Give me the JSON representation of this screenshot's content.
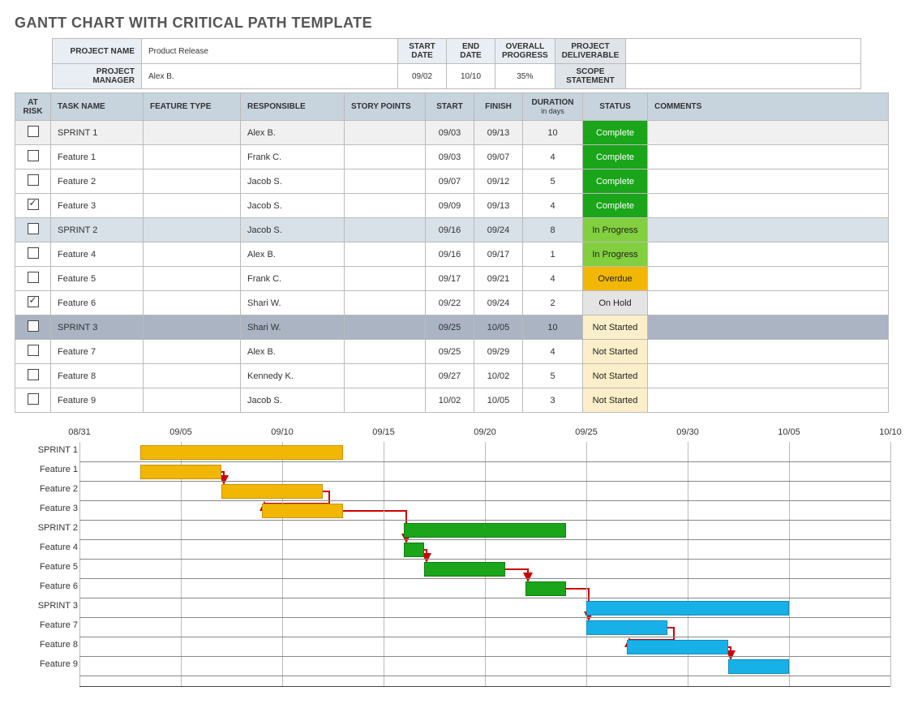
{
  "title": "GANTT CHART WITH CRITICAL PATH TEMPLATE",
  "info": {
    "labels": {
      "project_name": "PROJECT NAME",
      "project_manager": "PROJECT MANAGER",
      "start_date": "START DATE",
      "end_date": "END DATE",
      "overall_progress": "OVERALL PROGRESS",
      "deliverable": "PROJECT DELIVERABLE",
      "scope": "SCOPE STATEMENT"
    },
    "project_name": "Product Release",
    "project_manager": "Alex B.",
    "start_date": "09/02",
    "end_date": "10/10",
    "overall_progress": "35%"
  },
  "columns": {
    "at_risk": "AT RISK",
    "task_name": "TASK NAME",
    "feature_type": "FEATURE TYPE",
    "responsible": "RESPONSIBLE",
    "story_points": "STORY POINTS",
    "start": "START",
    "finish": "FINISH",
    "duration": "DURATION",
    "duration_sub": "in days",
    "status": "STATUS",
    "comments": "COMMENTS"
  },
  "rows": [
    {
      "risk": false,
      "name": "SPRINT 1",
      "resp": "Alex B.",
      "start": "09/03",
      "finish": "09/13",
      "dur": "10",
      "status": "Complete",
      "stclass": "st-complete",
      "cls": "sprint1"
    },
    {
      "risk": false,
      "name": "Feature 1",
      "resp": "Frank C.",
      "start": "09/03",
      "finish": "09/07",
      "dur": "4",
      "status": "Complete",
      "stclass": "st-complete",
      "cls": ""
    },
    {
      "risk": false,
      "name": "Feature 2",
      "resp": "Jacob S.",
      "start": "09/07",
      "finish": "09/12",
      "dur": "5",
      "status": "Complete",
      "stclass": "st-complete",
      "cls": ""
    },
    {
      "risk": true,
      "name": "Feature 3",
      "resp": "Jacob S.",
      "start": "09/09",
      "finish": "09/13",
      "dur": "4",
      "status": "Complete",
      "stclass": "st-complete",
      "cls": ""
    },
    {
      "risk": false,
      "name": "SPRINT 2",
      "resp": "Jacob S.",
      "start": "09/16",
      "finish": "09/24",
      "dur": "8",
      "status": "In Progress",
      "stclass": "st-inprogress",
      "cls": "sprint2"
    },
    {
      "risk": false,
      "name": "Feature 4",
      "resp": "Alex B.",
      "start": "09/16",
      "finish": "09/17",
      "dur": "1",
      "status": "In Progress",
      "stclass": "st-inprogress",
      "cls": ""
    },
    {
      "risk": false,
      "name": "Feature 5",
      "resp": "Frank C.",
      "start": "09/17",
      "finish": "09/21",
      "dur": "4",
      "status": "Overdue",
      "stclass": "st-overdue",
      "cls": ""
    },
    {
      "risk": true,
      "name": "Feature 6",
      "resp": "Shari W.",
      "start": "09/22",
      "finish": "09/24",
      "dur": "2",
      "status": "On Hold",
      "stclass": "st-onhold",
      "cls": ""
    },
    {
      "risk": false,
      "name": "SPRINT 3",
      "resp": "Shari W.",
      "start": "09/25",
      "finish": "10/05",
      "dur": "10",
      "status": "Not Started",
      "stclass": "st-notstarted",
      "cls": "sprint3"
    },
    {
      "risk": false,
      "name": "Feature 7",
      "resp": "Alex B.",
      "start": "09/25",
      "finish": "09/29",
      "dur": "4",
      "status": "Not Started",
      "stclass": "st-notstarted",
      "cls": ""
    },
    {
      "risk": false,
      "name": "Feature 8",
      "resp": "Kennedy K.",
      "start": "09/27",
      "finish": "10/02",
      "dur": "5",
      "status": "Not Started",
      "stclass": "st-notstarted",
      "cls": ""
    },
    {
      "risk": false,
      "name": "Feature 9",
      "resp": "Jacob S.",
      "start": "10/02",
      "finish": "10/05",
      "dur": "3",
      "status": "Not Started",
      "stclass": "st-notstarted",
      "cls": ""
    }
  ],
  "chart_data": {
    "type": "gantt",
    "title": "",
    "x_axis": {
      "start": "08/31",
      "end": "10/10",
      "ticks": [
        "08/31",
        "09/05",
        "09/10",
        "09/15",
        "09/20",
        "09/25",
        "09/30",
        "10/05",
        "10/10"
      ]
    },
    "tasks": [
      {
        "name": "SPRINT 1",
        "start": "09/03",
        "end": "09/13",
        "color": "yellow"
      },
      {
        "name": "Feature 1",
        "start": "09/03",
        "end": "09/07",
        "color": "yellow"
      },
      {
        "name": "Feature 2",
        "start": "09/07",
        "end": "09/12",
        "color": "yellow"
      },
      {
        "name": "Feature 3",
        "start": "09/09",
        "end": "09/13",
        "color": "yellow"
      },
      {
        "name": "SPRINT 2",
        "start": "09/16",
        "end": "09/24",
        "color": "green"
      },
      {
        "name": "Feature 4",
        "start": "09/16",
        "end": "09/17",
        "color": "green"
      },
      {
        "name": "Feature 5",
        "start": "09/17",
        "end": "09/21",
        "color": "green"
      },
      {
        "name": "Feature 6",
        "start": "09/22",
        "end": "09/24",
        "color": "green"
      },
      {
        "name": "SPRINT 3",
        "start": "09/25",
        "end": "10/05",
        "color": "blue"
      },
      {
        "name": "Feature 7",
        "start": "09/25",
        "end": "09/29",
        "color": "blue"
      },
      {
        "name": "Feature 8",
        "start": "09/27",
        "end": "10/02",
        "color": "blue"
      },
      {
        "name": "Feature 9",
        "start": "10/02",
        "end": "10/05",
        "color": "blue"
      }
    ],
    "critical_path_arrows": [
      {
        "from": "Feature 1",
        "to": "Feature 2"
      },
      {
        "from": "Feature 2",
        "to": "Feature 3"
      },
      {
        "from": "Feature 3",
        "to": "Feature 4"
      },
      {
        "from": "Feature 4",
        "to": "Feature 5"
      },
      {
        "from": "Feature 5",
        "to": "Feature 6"
      },
      {
        "from": "Feature 6",
        "to": "Feature 7"
      },
      {
        "from": "Feature 7",
        "to": "Feature 8"
      },
      {
        "from": "Feature 8",
        "to": "Feature 9"
      }
    ]
  }
}
